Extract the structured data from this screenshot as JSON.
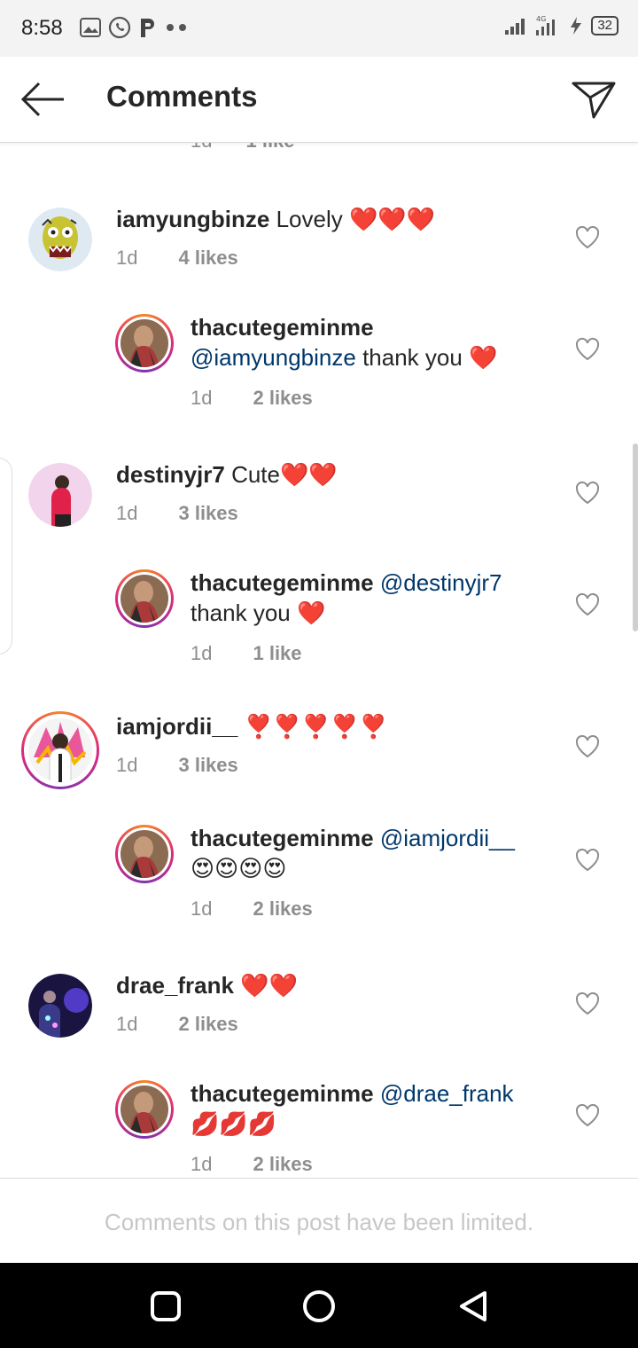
{
  "status": {
    "time": "8:58",
    "battery": "32"
  },
  "header": {
    "title": "Comments",
    "back_icon": "arrow-left-icon",
    "send_icon": "paper-plane-icon"
  },
  "partial_row": {
    "time": "1d",
    "likes": "1 like"
  },
  "comments": [
    {
      "user": "iamyungbinze",
      "mention": "",
      "text": "Lovely ❤️❤️❤️",
      "time": "1d",
      "likes": "4 likes",
      "is_reply": false
    },
    {
      "user": "thacutegeminme",
      "mention": "@iamyungbinze",
      "text": "thank you ❤️",
      "time": "1d",
      "likes": "2 likes",
      "is_reply": true
    },
    {
      "user": "destinyjr7",
      "mention": "",
      "text": "Cute❤️❤️",
      "time": "1d",
      "likes": "3 likes",
      "is_reply": false
    },
    {
      "user": "thacutegeminme",
      "mention": "@destinyjr7",
      "text": "thank you ❤️",
      "time": "1d",
      "likes": "1 like",
      "is_reply": true
    },
    {
      "user": "iamjordii__",
      "mention": "",
      "text": "❣️❣️❣️❣️❣️",
      "time": "1d",
      "likes": "3 likes",
      "is_reply": false
    },
    {
      "user": "thacutegeminme",
      "mention": "@iamjordii__",
      "text": "😍😍😍😍",
      "time": "1d",
      "likes": "2 likes",
      "is_reply": true
    },
    {
      "user": "drae_frank",
      "mention": "",
      "text": "❤️❤️",
      "time": "1d",
      "likes": "2 likes",
      "is_reply": false
    },
    {
      "user": "thacutegeminme",
      "mention": "@drae_frank",
      "text": "💋💋💋",
      "time": "1d",
      "likes": "2 likes",
      "is_reply": true
    }
  ],
  "footer": {
    "limited_text": "Comments on this post have been limited."
  },
  "colors": {
    "link": "#00376b",
    "meta": "#8e8e8e",
    "text": "#262626",
    "story_ring": "#dd2a7b"
  }
}
